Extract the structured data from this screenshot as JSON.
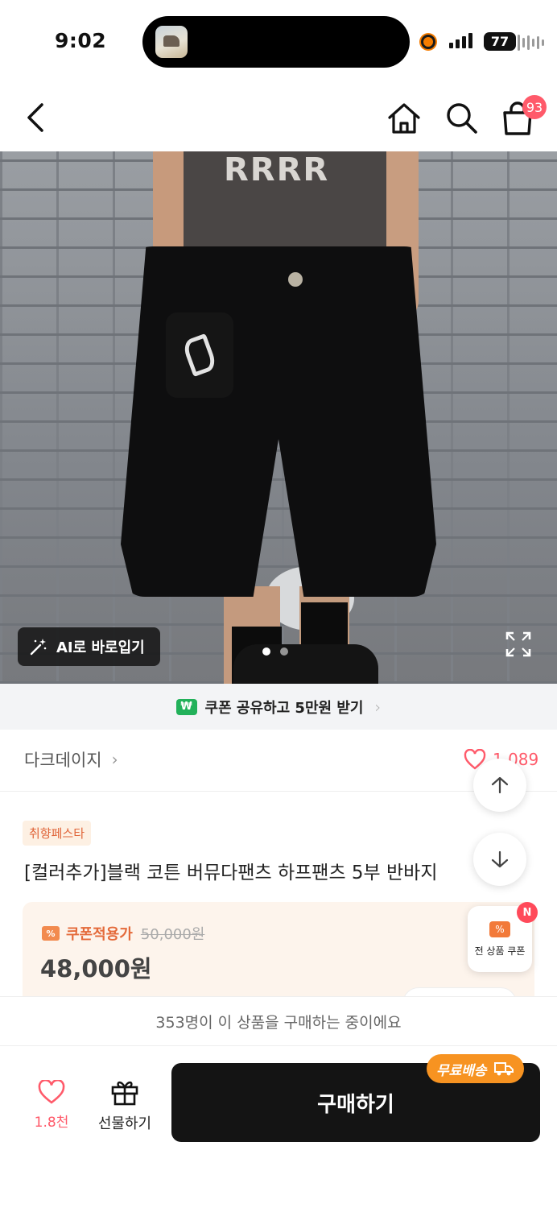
{
  "status_bar": {
    "time": "9:02",
    "battery": "77"
  },
  "nav": {
    "icons": [
      "back-icon",
      "home-icon",
      "search-icon",
      "shopping-bag-icon"
    ],
    "cart_count": "93"
  },
  "hero": {
    "shirt_print": "RRRR",
    "ai_button_label": "AI로 바로입기",
    "pager": {
      "count": 2,
      "active": 0
    }
  },
  "share_bar": {
    "badge": "₩",
    "label": "쿠폰 공유하고 5만원 받기"
  },
  "brand": {
    "name": "다크데이지",
    "like_count": "1,089"
  },
  "product": {
    "tag": "취향페스타",
    "title": "[컬러추가]블랙 코튼 버뮤다팬츠 하프팬츠 5부 반바지",
    "coupon_label": "쿠폰적용가",
    "original_price": "50,000원",
    "sale_price": "48,000원"
  },
  "floating": {
    "all_coupon_label": "전 상품 쿠폰",
    "new_badge": "N"
  },
  "social_proof": "353명이 이 상품을 구매하는 중이에요",
  "bottom_bar": {
    "like_label": "1.8천",
    "gift_label": "선물하기",
    "buy_label": "구매하기",
    "free_shipping": "무료배송"
  },
  "colors": {
    "accent_red": "#ff5a6a",
    "coupon_orange": "#f27a3a",
    "ship_orange": "#f79321",
    "buy_button": "#141414",
    "won_green": "#22b15a"
  }
}
